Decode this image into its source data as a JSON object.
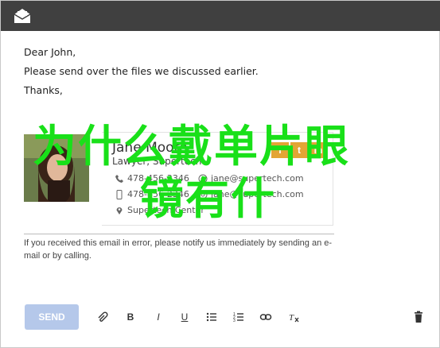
{
  "email": {
    "greeting": "Dear John,",
    "line1": "Please send over the files we discussed earlier.",
    "line2": "Thanks,"
  },
  "signature": {
    "name": "Jane Moore",
    "role": "Lawyer, Supertech",
    "contacts": [
      {
        "icon": "phone-icon",
        "text": "478-456-2346"
      },
      {
        "icon": "mobile-icon",
        "text": "478-456-2346"
      },
      {
        "icon": "location-icon",
        "text": "Supertech Center"
      }
    ],
    "emails": [
      {
        "icon": "email-icon",
        "text": "jane@supertech.com"
      },
      {
        "icon": "email-icon",
        "text": "jane@supertech.com"
      }
    ],
    "social_icons": [
      "facebook-icon",
      "twitter-icon",
      "linkedin-icon"
    ]
  },
  "disclaimer": "If you received this email in error, please notify us immediately by sending an e-mail or by calling.",
  "overlay_text": {
    "line1": "为什么戴单片眼",
    "line2": "镜有什"
  },
  "toolbar": {
    "send_label": "SEND",
    "buttons": [
      "attach-icon",
      "bold-icon",
      "italic-icon",
      "underline-icon",
      "bulleted-list-icon",
      "numbered-list-icon",
      "link-icon",
      "clear-format-icon"
    ],
    "delete": "trash-icon"
  },
  "colors": {
    "titlebar": "#404040",
    "send_button": "#b5c8ea",
    "overlay_text": "#19e019",
    "social_chip": "#e3a535"
  }
}
